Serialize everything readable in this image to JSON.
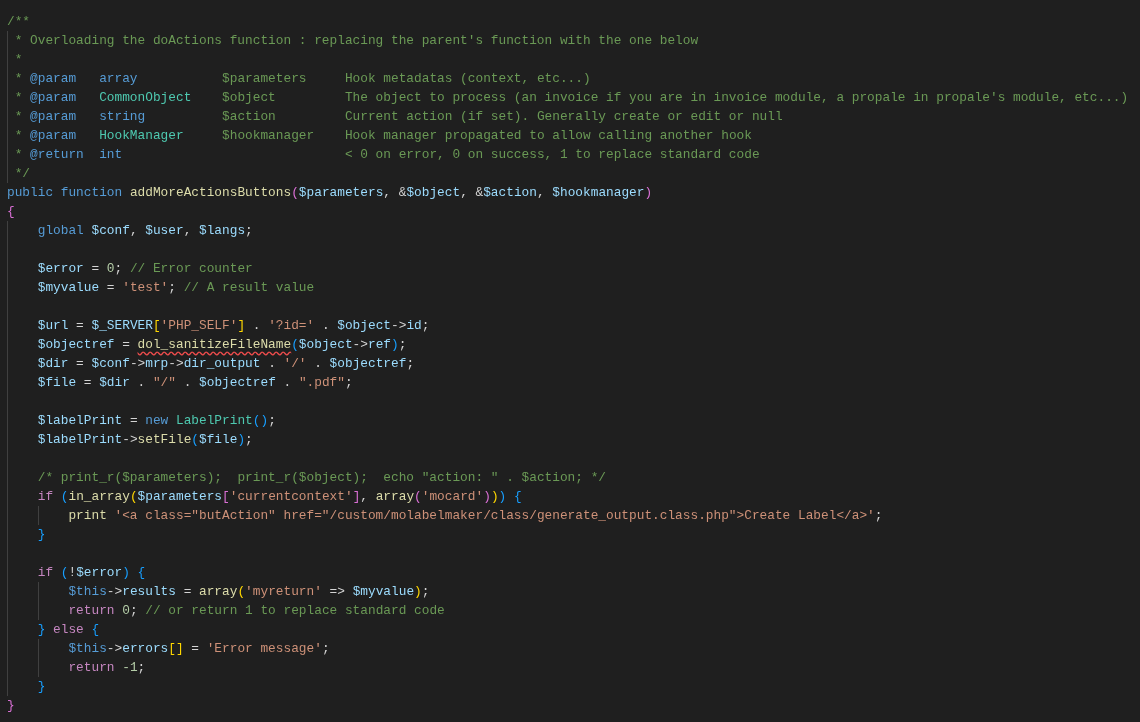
{
  "editor": {
    "lines": [
      {
        "kind": "code",
        "tokens": [
          {
            "kind": "comment",
            "text": "/**"
          }
        ]
      },
      {
        "kind": "code",
        "tokens": [
          {
            "kind": "comment",
            "text": " * Overloading the doActions function : replacing the parent's function with the one below"
          }
        ]
      },
      {
        "kind": "code",
        "tokens": [
          {
            "kind": "comment",
            "text": " *"
          }
        ]
      },
      {
        "kind": "code",
        "tokens": [
          {
            "kind": "comment",
            "text": " * "
          },
          {
            "kind": "keyword",
            "text": "@param   "
          },
          {
            "kind": "keyword",
            "text": "array"
          },
          {
            "kind": "comment",
            "text": "           $parameters     Hook metadatas (context, etc...)"
          }
        ]
      },
      {
        "kind": "code",
        "tokens": [
          {
            "kind": "comment",
            "text": " * "
          },
          {
            "kind": "keyword",
            "text": "@param   "
          },
          {
            "kind": "class",
            "text": "CommonObject"
          },
          {
            "kind": "comment",
            "text": "    $object         The object to process (an invoice if you are in invoice module, a propale in propale's module, etc...)"
          }
        ]
      },
      {
        "kind": "code",
        "tokens": [
          {
            "kind": "comment",
            "text": " * "
          },
          {
            "kind": "keyword",
            "text": "@param   "
          },
          {
            "kind": "keyword",
            "text": "string"
          },
          {
            "kind": "comment",
            "text": "          $action         Current action (if set). Generally create or edit or null"
          }
        ]
      },
      {
        "kind": "code",
        "tokens": [
          {
            "kind": "comment",
            "text": " * "
          },
          {
            "kind": "keyword",
            "text": "@param   "
          },
          {
            "kind": "class",
            "text": "HookManager"
          },
          {
            "kind": "comment",
            "text": "     $hookmanager    Hook manager propagated to allow calling another hook"
          }
        ]
      },
      {
        "kind": "code",
        "tokens": [
          {
            "kind": "comment",
            "text": " * "
          },
          {
            "kind": "keyword",
            "text": "@return  "
          },
          {
            "kind": "keyword",
            "text": "int"
          },
          {
            "kind": "comment",
            "text": "                             < 0 on error, 0 on success, 1 to replace standard code"
          }
        ]
      },
      {
        "kind": "code",
        "tokens": [
          {
            "kind": "comment",
            "text": " */"
          }
        ]
      },
      {
        "kind": "code",
        "tokens": [
          {
            "kind": "keyword",
            "text": "public function "
          },
          {
            "kind": "function",
            "text": "addMoreActionsButtons"
          },
          {
            "kind": "bracket_pink",
            "text": "("
          },
          {
            "kind": "variable",
            "text": "$parameters"
          },
          {
            "kind": "plain",
            "text": ", &"
          },
          {
            "kind": "variable",
            "text": "$object"
          },
          {
            "kind": "plain",
            "text": ", &"
          },
          {
            "kind": "variable",
            "text": "$action"
          },
          {
            "kind": "plain",
            "text": ", "
          },
          {
            "kind": "variable",
            "text": "$hookmanager"
          },
          {
            "kind": "bracket_pink",
            "text": ")"
          }
        ]
      },
      {
        "kind": "code",
        "tokens": [
          {
            "kind": "bracket_pink",
            "text": "{"
          }
        ]
      },
      {
        "kind": "code",
        "tokens": [
          {
            "kind": "keyword",
            "text": "    global "
          },
          {
            "kind": "variable",
            "text": "$conf"
          },
          {
            "kind": "plain",
            "text": ", "
          },
          {
            "kind": "variable",
            "text": "$user"
          },
          {
            "kind": "plain",
            "text": ", "
          },
          {
            "kind": "variable",
            "text": "$langs"
          },
          {
            "kind": "plain",
            "text": ";"
          }
        ]
      },
      {
        "kind": "blank"
      },
      {
        "kind": "code",
        "tokens": [
          {
            "kind": "variable",
            "text": "    $error"
          },
          {
            "kind": "plain",
            "text": " = "
          },
          {
            "kind": "number",
            "text": "0"
          },
          {
            "kind": "plain",
            "text": "; "
          },
          {
            "kind": "comment",
            "text": "// Error counter"
          }
        ]
      },
      {
        "kind": "code",
        "tokens": [
          {
            "kind": "variable",
            "text": "    $myvalue"
          },
          {
            "kind": "plain",
            "text": " = "
          },
          {
            "kind": "string",
            "text": "'test'"
          },
          {
            "kind": "plain",
            "text": "; "
          },
          {
            "kind": "comment",
            "text": "// A result value"
          }
        ]
      },
      {
        "kind": "blank"
      },
      {
        "kind": "code",
        "tokens": [
          {
            "kind": "variable",
            "text": "    $url"
          },
          {
            "kind": "plain",
            "text": " = "
          },
          {
            "kind": "variable",
            "text": "$_SERVER"
          },
          {
            "kind": "bracket_gold",
            "text": "["
          },
          {
            "kind": "string",
            "text": "'PHP_SELF'"
          },
          {
            "kind": "bracket_gold",
            "text": "]"
          },
          {
            "kind": "plain",
            "text": " . "
          },
          {
            "kind": "string",
            "text": "'?id='"
          },
          {
            "kind": "plain",
            "text": " . "
          },
          {
            "kind": "variable",
            "text": "$object"
          },
          {
            "kind": "plain",
            "text": "->"
          },
          {
            "kind": "variable",
            "text": "id"
          },
          {
            "kind": "plain",
            "text": ";"
          }
        ]
      },
      {
        "kind": "code",
        "tokens": [
          {
            "kind": "variable",
            "text": "    $objectref"
          },
          {
            "kind": "plain",
            "text": " = "
          },
          {
            "kind": "function_flagged",
            "text": "dol_sanitizeFileName"
          },
          {
            "kind": "bracket_blue",
            "text": "("
          },
          {
            "kind": "variable",
            "text": "$object"
          },
          {
            "kind": "plain",
            "text": "->"
          },
          {
            "kind": "variable",
            "text": "ref"
          },
          {
            "kind": "bracket_blue",
            "text": ")"
          },
          {
            "kind": "plain",
            "text": ";"
          }
        ]
      },
      {
        "kind": "code",
        "tokens": [
          {
            "kind": "variable",
            "text": "    $dir"
          },
          {
            "kind": "plain",
            "text": " = "
          },
          {
            "kind": "variable",
            "text": "$conf"
          },
          {
            "kind": "plain",
            "text": "->"
          },
          {
            "kind": "variable",
            "text": "mrp"
          },
          {
            "kind": "plain",
            "text": "->"
          },
          {
            "kind": "variable",
            "text": "dir_output"
          },
          {
            "kind": "plain",
            "text": " . "
          },
          {
            "kind": "string",
            "text": "'/'"
          },
          {
            "kind": "plain",
            "text": " . "
          },
          {
            "kind": "variable",
            "text": "$objectref"
          },
          {
            "kind": "plain",
            "text": ";"
          }
        ]
      },
      {
        "kind": "code",
        "tokens": [
          {
            "kind": "variable",
            "text": "    $file"
          },
          {
            "kind": "plain",
            "text": " = "
          },
          {
            "kind": "variable",
            "text": "$dir"
          },
          {
            "kind": "plain",
            "text": " . "
          },
          {
            "kind": "string",
            "text": "\"/\""
          },
          {
            "kind": "plain",
            "text": " . "
          },
          {
            "kind": "variable",
            "text": "$objectref"
          },
          {
            "kind": "plain",
            "text": " . "
          },
          {
            "kind": "string",
            "text": "\".pdf\""
          },
          {
            "kind": "plain",
            "text": ";"
          }
        ]
      },
      {
        "kind": "blank"
      },
      {
        "kind": "code",
        "tokens": [
          {
            "kind": "variable",
            "text": "    $labelPrint"
          },
          {
            "kind": "plain",
            "text": " = "
          },
          {
            "kind": "keyword",
            "text": "new "
          },
          {
            "kind": "class",
            "text": "LabelPrint"
          },
          {
            "kind": "bracket_blue",
            "text": "()"
          },
          {
            "kind": "plain",
            "text": ";"
          }
        ]
      },
      {
        "kind": "code",
        "tokens": [
          {
            "kind": "variable",
            "text": "    $labelPrint"
          },
          {
            "kind": "plain",
            "text": "->"
          },
          {
            "kind": "function",
            "text": "setFile"
          },
          {
            "kind": "bracket_blue",
            "text": "("
          },
          {
            "kind": "variable",
            "text": "$file"
          },
          {
            "kind": "bracket_blue",
            "text": ")"
          },
          {
            "kind": "plain",
            "text": ";"
          }
        ]
      },
      {
        "kind": "blank"
      },
      {
        "kind": "code",
        "tokens": [
          {
            "kind": "comment",
            "text": "    /* print_r($parameters);  print_r($object);  echo \"action: \" . $action; */"
          }
        ]
      },
      {
        "kind": "code",
        "tokens": [
          {
            "kind": "control",
            "text": "    if "
          },
          {
            "kind": "bracket_blue",
            "text": "("
          },
          {
            "kind": "function",
            "text": "in_array"
          },
          {
            "kind": "bracket_gold",
            "text": "("
          },
          {
            "kind": "variable",
            "text": "$parameters"
          },
          {
            "kind": "bracket_pink",
            "text": "["
          },
          {
            "kind": "string",
            "text": "'currentcontext'"
          },
          {
            "kind": "bracket_pink",
            "text": "]"
          },
          {
            "kind": "plain",
            "text": ", "
          },
          {
            "kind": "function",
            "text": "array"
          },
          {
            "kind": "bracket_pink",
            "text": "("
          },
          {
            "kind": "string",
            "text": "'mocard'"
          },
          {
            "kind": "bracket_pink",
            "text": ")"
          },
          {
            "kind": "bracket_gold",
            "text": ")"
          },
          {
            "kind": "bracket_blue",
            "text": ") {"
          }
        ]
      },
      {
        "kind": "code",
        "tokens": [
          {
            "kind": "function",
            "text": "        print "
          },
          {
            "kind": "string",
            "text": "'<a class=\"butAction\" href=\"/custom/molabelmaker/class/generate_output.class.php\">Create Label</a>'"
          },
          {
            "kind": "plain",
            "text": ";"
          }
        ]
      },
      {
        "kind": "code",
        "tokens": [
          {
            "kind": "bracket_blue",
            "text": "    }"
          }
        ]
      },
      {
        "kind": "blank"
      },
      {
        "kind": "code",
        "tokens": [
          {
            "kind": "control",
            "text": "    if "
          },
          {
            "kind": "bracket_blue",
            "text": "("
          },
          {
            "kind": "plain",
            "text": "!"
          },
          {
            "kind": "variable",
            "text": "$error"
          },
          {
            "kind": "bracket_blue",
            "text": ") {"
          }
        ]
      },
      {
        "kind": "code",
        "tokens": [
          {
            "kind": "keyword",
            "text": "        $this"
          },
          {
            "kind": "plain",
            "text": "->"
          },
          {
            "kind": "variable",
            "text": "results"
          },
          {
            "kind": "plain",
            "text": " = "
          },
          {
            "kind": "function",
            "text": "array"
          },
          {
            "kind": "bracket_gold",
            "text": "("
          },
          {
            "kind": "string",
            "text": "'myreturn'"
          },
          {
            "kind": "plain",
            "text": " => "
          },
          {
            "kind": "variable",
            "text": "$myvalue"
          },
          {
            "kind": "bracket_gold",
            "text": ")"
          },
          {
            "kind": "plain",
            "text": ";"
          }
        ]
      },
      {
        "kind": "code",
        "tokens": [
          {
            "kind": "control",
            "text": "        return "
          },
          {
            "kind": "number",
            "text": "0"
          },
          {
            "kind": "plain",
            "text": "; "
          },
          {
            "kind": "comment",
            "text": "// or return 1 to replace standard code"
          }
        ]
      },
      {
        "kind": "code",
        "tokens": [
          {
            "kind": "bracket_blue",
            "text": "    } "
          },
          {
            "kind": "control",
            "text": "else "
          },
          {
            "kind": "bracket_blue",
            "text": "{"
          }
        ]
      },
      {
        "kind": "code",
        "tokens": [
          {
            "kind": "keyword",
            "text": "        $this"
          },
          {
            "kind": "plain",
            "text": "->"
          },
          {
            "kind": "variable",
            "text": "errors"
          },
          {
            "kind": "bracket_gold",
            "text": "[]"
          },
          {
            "kind": "plain",
            "text": " = "
          },
          {
            "kind": "string",
            "text": "'Error message'"
          },
          {
            "kind": "plain",
            "text": ";"
          }
        ]
      },
      {
        "kind": "code",
        "tokens": [
          {
            "kind": "control",
            "text": "        return "
          },
          {
            "kind": "number",
            "text": "-1"
          },
          {
            "kind": "plain",
            "text": ";"
          }
        ]
      },
      {
        "kind": "code",
        "tokens": [
          {
            "kind": "bracket_blue",
            "text": "    }"
          }
        ]
      },
      {
        "kind": "code",
        "tokens": [
          {
            "kind": "bracket_pink",
            "text": "}"
          }
        ]
      }
    ]
  }
}
